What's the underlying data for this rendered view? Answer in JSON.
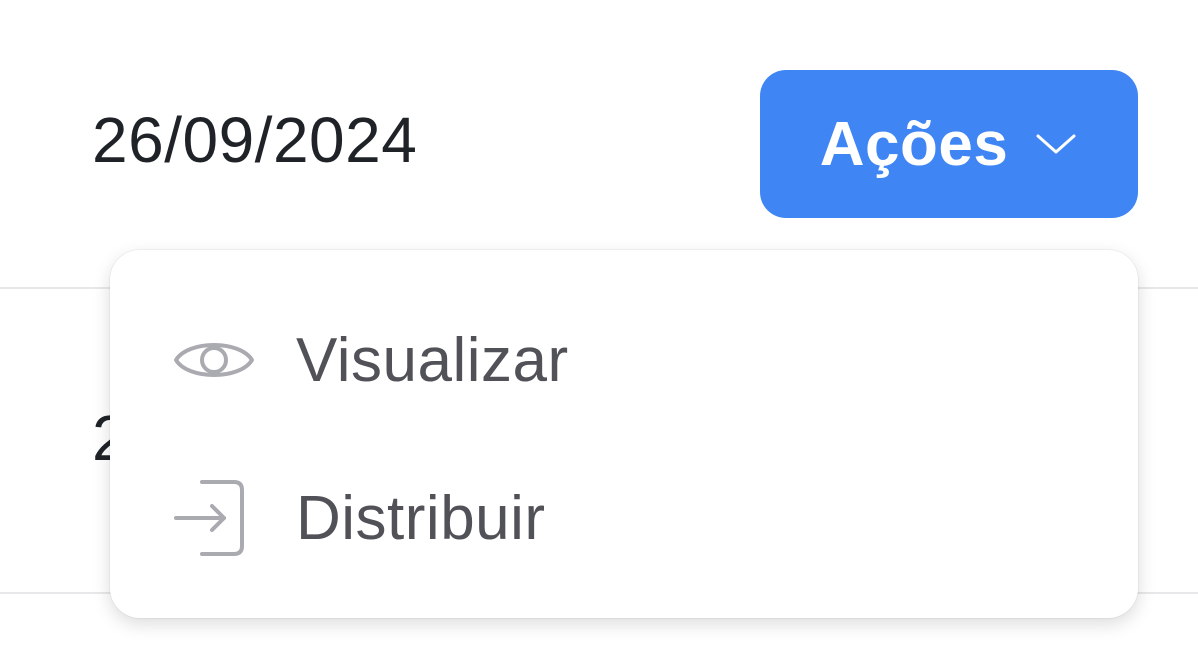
{
  "table": {
    "row1": {
      "date": "26/09/2024"
    },
    "row2": {
      "date_partial": "2"
    }
  },
  "actions": {
    "label": "Ações",
    "icon": "chevron-down-icon"
  },
  "menu": {
    "items": [
      {
        "label": "Visualizar",
        "icon": "eye-icon"
      },
      {
        "label": "Distribuir",
        "icon": "sign-in-icon"
      }
    ]
  },
  "colors": {
    "button_bg": "#3f86f4",
    "button_text": "#ffffff",
    "menu_text": "#505258",
    "menu_icon": "#a9abb0",
    "body_text": "#1f2328",
    "divider": "#e8e8ea"
  }
}
